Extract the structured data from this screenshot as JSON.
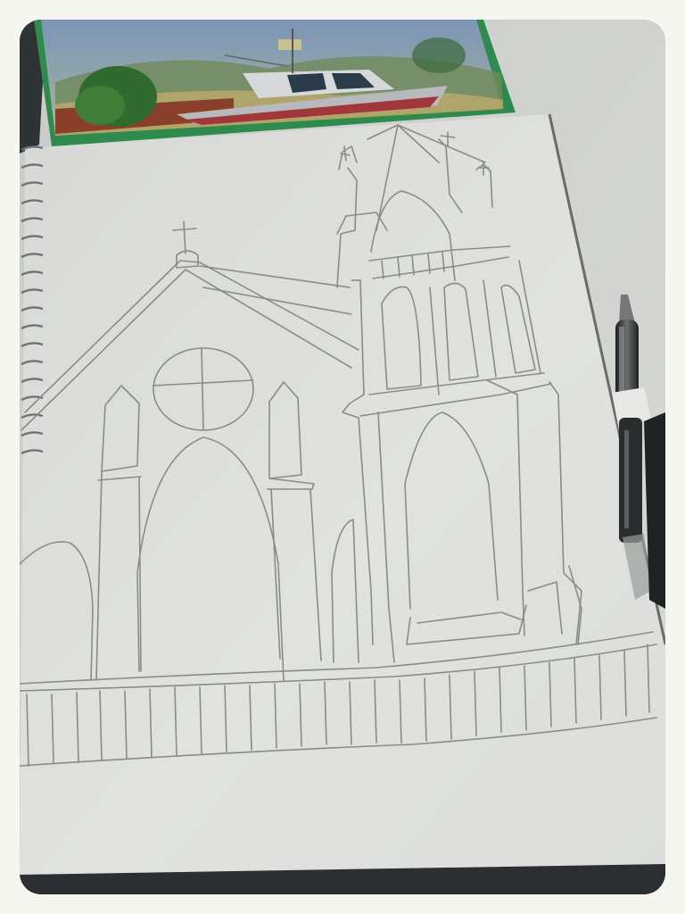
{
  "photo": {
    "subject": "pencil-sketch-of-church-on-spiral-sketchbook",
    "colors": {
      "border": "#f6f6f1",
      "table": "#d2d4d1",
      "paper": "#dedfdc",
      "pencil_line": "#8a8c88",
      "folder_green": "#2f8a4e",
      "pen_body": "#2a2d2e"
    }
  }
}
